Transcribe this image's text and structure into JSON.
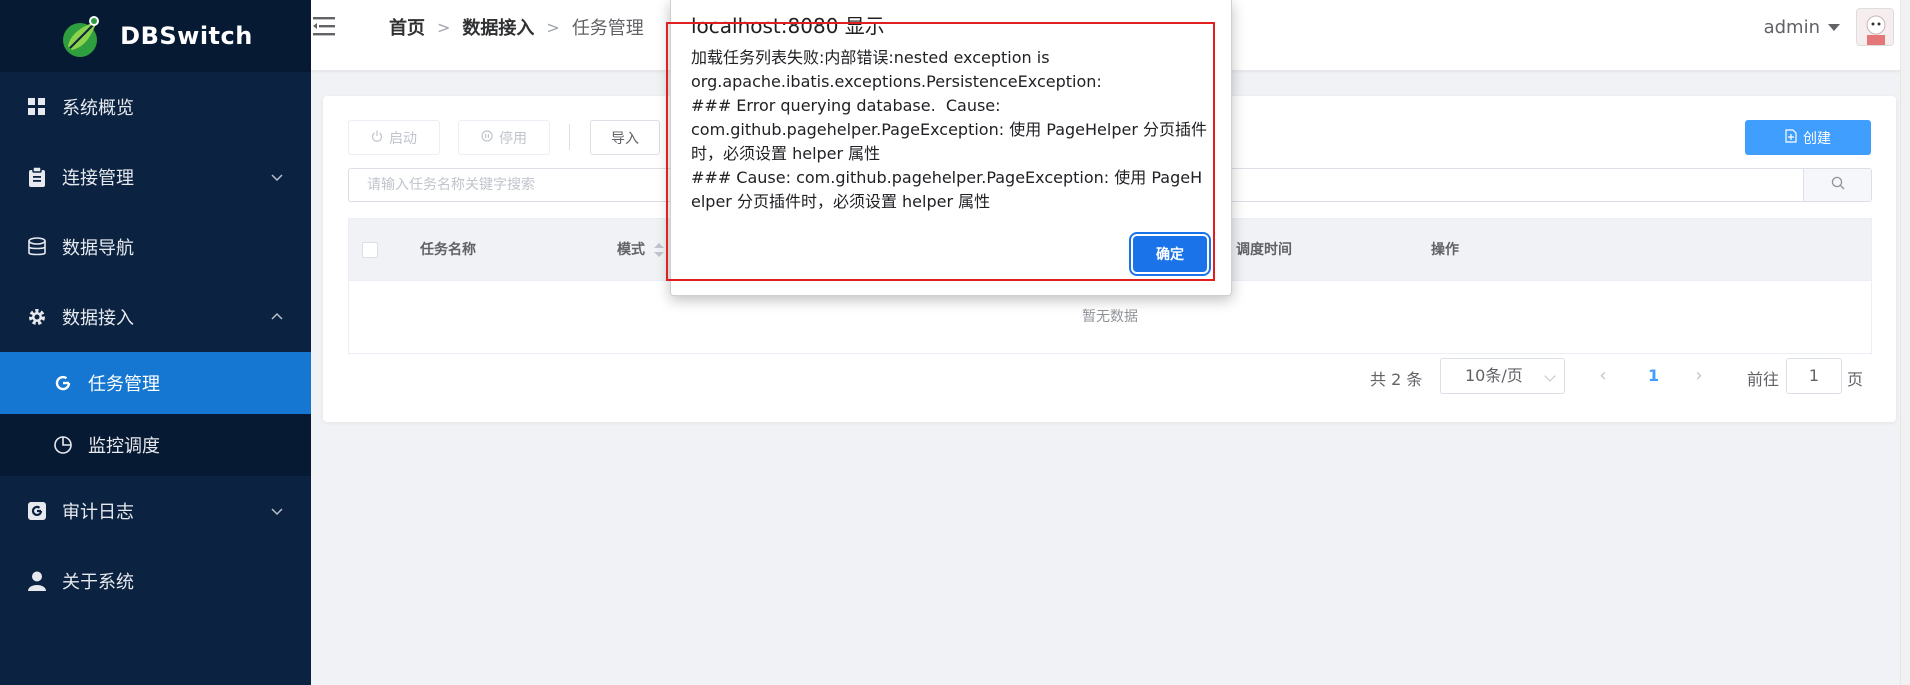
{
  "app": {
    "name": "DBSwitch"
  },
  "sidebar": {
    "items": [
      {
        "label": "系统概览",
        "icon": "grid-icon"
      },
      {
        "label": "连接管理",
        "icon": "clipboard-icon",
        "expandable": true
      },
      {
        "label": "数据导航",
        "icon": "database-icon"
      },
      {
        "label": "数据接入",
        "icon": "gear-icon",
        "expandable": true,
        "expanded": true,
        "children": [
          {
            "label": "任务管理",
            "icon": "refresh-icon",
            "active": true
          },
          {
            "label": "监控调度",
            "icon": "pie-icon"
          }
        ]
      },
      {
        "label": "审计日志",
        "icon": "audit-icon",
        "expandable": true
      },
      {
        "label": "关于系统",
        "icon": "user-icon"
      }
    ]
  },
  "header": {
    "breadcrumb": [
      "首页",
      "数据接入",
      "任务管理"
    ],
    "username": "admin"
  },
  "toolbar": {
    "start_label": "启动",
    "stop_label": "停用",
    "import_label": "导入",
    "create_label": "创建"
  },
  "search": {
    "placeholder": "请输入任务名称关键字搜索"
  },
  "table": {
    "columns": [
      "任务名称",
      "模式",
      "调度时间",
      "操作"
    ],
    "empty_text": "暂无数据"
  },
  "pagination": {
    "total_text": "共 2 条",
    "page_size": "10条/页",
    "current_page": "1",
    "goto_label": "前往",
    "goto_value": "1",
    "page_unit": "页"
  },
  "dialog": {
    "title": "localhost:8080 显示",
    "message": "加载任务列表失败:内部错误:nested exception is\norg.apache.ibatis.exceptions.PersistenceException:\n### Error querying database.  Cause:\ncom.github.pagehelper.PageException: 使用 PageHelper 分页插件时，必须设置 helper 属性\n### Cause: com.github.pagehelper.PageException: 使用 PageHelper 分页插件时，必须设置 helper 属性",
    "ok_label": "确定"
  },
  "colors": {
    "sidebar_bg": "#0b2240",
    "active_menu": "#1577d1",
    "primary": "#409eff",
    "dialog_button": "#1a73e8",
    "highlight": "#e02020"
  }
}
